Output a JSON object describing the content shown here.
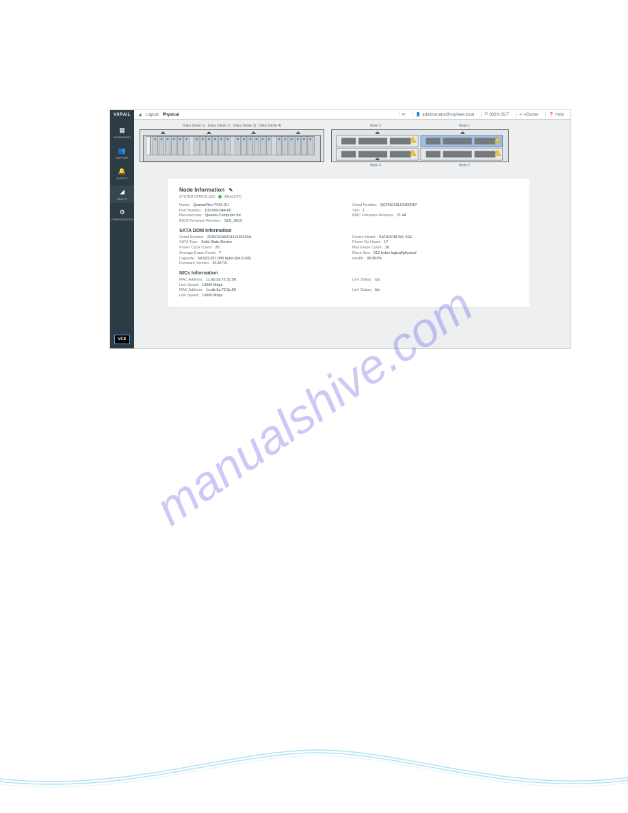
{
  "watermark": "manualshive.com",
  "sidebar": {
    "brand": "VXRAIL",
    "items": [
      {
        "label": "DASHBOARD",
        "icon": "▦"
      },
      {
        "label": "SUPPORT",
        "icon": "👥"
      },
      {
        "label": "EVENTS",
        "icon": "🔔"
      },
      {
        "label": "HEALTH",
        "icon": "◢"
      },
      {
        "label": "CONFIGURATION",
        "icon": "⚙"
      }
    ],
    "footer_logo": "VCE"
  },
  "topbar": {
    "view_icon": "◢",
    "tabs": {
      "logical": "Logical",
      "physical": "Physical"
    },
    "user": "administrator@vsphere.local",
    "signout": "SIGN OUT",
    "vcenter": "vCenter",
    "help": "Help"
  },
  "chassis": {
    "disk_groups": [
      "Disks (Node 1)",
      "Disks (Node 2)",
      "Disks (Node 3)",
      "Disks (Node 4)"
    ],
    "back_nodes_top": [
      "Node 3",
      "Node 1"
    ],
    "back_nodes_bot": [
      "Node 4",
      "Node 2"
    ],
    "selected_node": "Node 1"
  },
  "node": {
    "title": "Node Information",
    "status_prefix": "SYSTEM STATUS LED:",
    "status_text": "[HEALTHY]",
    "info_left": [
      {
        "k": "Name:",
        "v": "QuantaPlex T41S-2U"
      },
      {
        "k": "Part Number:",
        "v": "100-569-044-00"
      },
      {
        "k": "Manufacturer:",
        "v": "Quanta Computer Inc"
      },
      {
        "k": "BIOS Firmware Revision:",
        "v": "S2S_3A19"
      }
    ],
    "info_right": [
      {
        "k": "Serial Number:",
        "v": "QCFNO16L6120001P"
      },
      {
        "k": "Slot:",
        "v": "1"
      },
      {
        "k": "BMC Firmware Revision:",
        "v": "21.44"
      }
    ]
  },
  "sata": {
    "title": "SATA DOM Information",
    "left": [
      {
        "k": "Serial Number:",
        "v": "20160224AA1111592403A"
      },
      {
        "k": "SATA Type:",
        "v": "Solid State Device"
      },
      {
        "k": "Power Cycle Count:",
        "v": "25"
      },
      {
        "k": "Average Erase Count:",
        "v": "7"
      },
      {
        "k": "Capacity:",
        "v": "64,023,257,088 bytes [64.0 GB]"
      },
      {
        "k": "Firmware Version:",
        "v": "S130710"
      }
    ],
    "right": [
      {
        "k": "Device Model:",
        "v": "SATADOM-WV 3SE"
      },
      {
        "k": "Power On Hours:",
        "v": "17"
      },
      {
        "k": "Max Erase Count:",
        "v": "26"
      },
      {
        "k": "Block Size:",
        "v": "512 bytes logical/physical"
      },
      {
        "k": "Health:",
        "v": "99.993%"
      }
    ]
  },
  "nics": {
    "title": "NICs Information",
    "left": [
      {
        "k": "MAC Address:",
        "v": "1c:ab:3a:72:3c:58"
      },
      {
        "k": "Link Speed:",
        "v": "10000 Mbps"
      },
      {
        "k": "MAC Address:",
        "v": "1c:ab:3a:72:3c:59"
      },
      {
        "k": "Link Speed:",
        "v": "10000 Mbps"
      }
    ],
    "right": [
      {
        "k": "Link Status:",
        "v": "Up"
      },
      {
        "k": "Link Status:",
        "v": "Up"
      }
    ]
  }
}
